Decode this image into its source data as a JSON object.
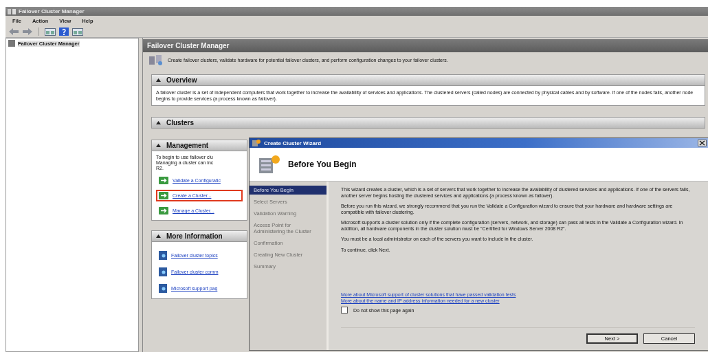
{
  "window": {
    "title": "Failover Cluster Manager"
  },
  "menu": [
    "File",
    "Action",
    "View",
    "Help"
  ],
  "toolbar": [
    {
      "kind": "back"
    },
    {
      "kind": "forward"
    },
    {
      "kind": "pane"
    },
    {
      "kind": "help"
    },
    {
      "kind": "pane"
    }
  ],
  "tree": [
    {
      "label": "Failover Cluster Manager",
      "selected": true
    }
  ],
  "main": {
    "title": "Failover Cluster Manager",
    "description": "Create failover clusters, validate hardware for potential failover clusters, and perform configuration changes to your failover clusters.",
    "sections": [
      {
        "title": "Overview",
        "expanded": true,
        "kind": "text",
        "text": "A failover cluster is a set of independent computers that work together to increase the availability of services and applications. The clustered servers (called nodes) are connected by physical cables and by software. If one of the nodes fails, another node begins to provide services (a process known as failover)."
      },
      {
        "title": "Clusters",
        "expanded": true,
        "kind": "empty"
      },
      {
        "title": "Management",
        "expanded": true,
        "kind": "actions",
        "text": [
          "To begin to use failover clu",
          "Managing a cluster can inc",
          "R2."
        ],
        "links": [
          {
            "label": "Validate a Configuratic",
            "highlighted": false
          },
          {
            "label": "Create a Cluster...",
            "highlighted": true
          },
          {
            "label": "Manage a Cluster...",
            "highlighted": false
          }
        ]
      },
      {
        "title": "More Information",
        "expanded": true,
        "kind": "help",
        "links": [
          {
            "label": "Failover cluster topics",
            "highlighted": false
          },
          {
            "label": "Failover cluster comm",
            "highlighted": false
          },
          {
            "label": "Microsoft support pag",
            "highlighted": false
          }
        ]
      }
    ]
  },
  "wizard": {
    "title": "Create Cluster Wizard",
    "heading": "Before You Begin",
    "steps": [
      {
        "label": "Before You Begin",
        "selected": true
      },
      {
        "label": "Select Servers",
        "selected": false
      },
      {
        "label": "Validation Warning",
        "selected": false
      },
      {
        "label": "Access Point for Administering the Cluster",
        "selected": false
      },
      {
        "label": "Confirmation",
        "selected": false
      },
      {
        "label": "Creating New Cluster",
        "selected": false
      },
      {
        "label": "Summary",
        "selected": false
      }
    ],
    "paragraphs": [
      "This wizard creates a cluster, which is a set of servers that work together to increase the availability of clustered services and applications. If one of the servers fails, another server begins hosting the clustered services and applications (a process known as failover).",
      "Before you run this wizard, we strongly recommend that you run the Validate a Configuration wizard to ensure that your hardware and hardware settings are compatible with failover clustering.",
      "Microsoft supports a cluster solution only if the complete configuration (servers, network, and storage) can pass all tests in the Validate a Configuration wizard. In addition, all hardware components in the cluster solution must be \"Certified for Windows Server 2008 R2\".",
      "You must be a local administrator on each of the servers you want to include in the cluster.",
      "To continue, click Next."
    ],
    "links": [
      "More about Microsoft support of cluster solutions that have passed validation tests",
      "More about the name and IP address information needed for a new cluster"
    ],
    "checkbox": {
      "label": "Do not show this page again",
      "checked": false
    },
    "buttons": [
      "Next >",
      "Cancel"
    ]
  }
}
